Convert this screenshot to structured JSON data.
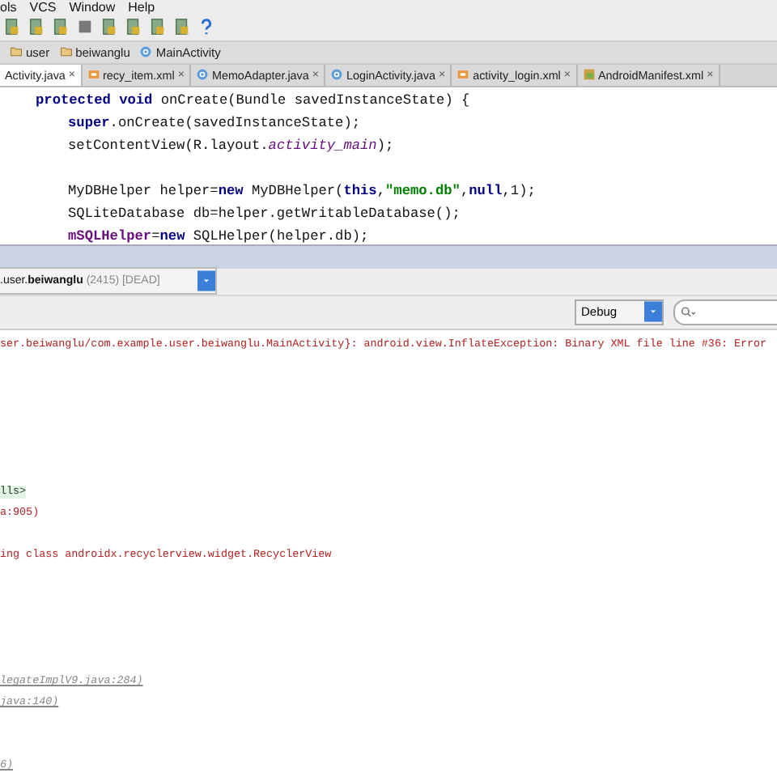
{
  "menu_bar": [
    "ols",
    "VCS",
    "Window",
    "Help"
  ],
  "toolbar": [
    {
      "kind": "tool"
    },
    {
      "kind": "tool"
    },
    {
      "kind": "tool"
    },
    {
      "kind": "stop"
    },
    {
      "kind": "tool"
    },
    {
      "kind": "tool"
    },
    {
      "kind": "tool"
    },
    {
      "kind": "tool"
    },
    {
      "kind": "help"
    }
  ],
  "breadcrumb": [
    {
      "label": "user",
      "kind": "folder"
    },
    {
      "label": "beiwanglu",
      "kind": "folder"
    },
    {
      "label": "MainActivity",
      "kind": "class"
    }
  ],
  "tabs": [
    {
      "label": "Activity.java",
      "kind": "none",
      "selected": true
    },
    {
      "label": "recy_item.xml",
      "kind": "xml",
      "selected": false
    },
    {
      "label": "MemoAdapter.java",
      "kind": "class",
      "selected": false
    },
    {
      "label": "LoginActivity.java",
      "kind": "class",
      "selected": false
    },
    {
      "label": "activity_login.xml",
      "kind": "xml",
      "selected": false
    },
    {
      "label": "AndroidManifest.xml",
      "kind": "manifest",
      "selected": false
    }
  ],
  "tab_close": "×",
  "code": [
    {
      "kind": "signature",
      "tokens": [
        {
          "text": "protected void ",
          "kind": "keyword"
        },
        {
          "text": "onCreate(Bundle savedInstanceState) {",
          "kind": "plain"
        }
      ]
    },
    {
      "kind": "body",
      "tokens": [
        {
          "text": "super",
          "kind": "keyword"
        },
        {
          "text": ".onCreate(savedInstanceState);",
          "kind": "plain"
        }
      ]
    },
    {
      "kind": "body",
      "tokens": [
        {
          "text": "setContentView(R.layout.",
          "kind": "plain"
        },
        {
          "text": "activity_main",
          "kind": "field"
        },
        {
          "text": ");",
          "kind": "plain"
        }
      ]
    },
    {
      "kind": "blank"
    },
    {
      "kind": "body",
      "tokens": [
        {
          "text": "MyDBHelper helper=",
          "kind": "plain"
        },
        {
          "text": "new ",
          "kind": "keyword"
        },
        {
          "text": "MyDBHelper(",
          "kind": "plain"
        },
        {
          "text": "this",
          "kind": "keyword"
        },
        {
          "text": ",",
          "kind": "plain"
        },
        {
          "text": "\"memo.db\"",
          "kind": "string"
        },
        {
          "text": ",",
          "kind": "plain"
        },
        {
          "text": "null",
          "kind": "keyword"
        },
        {
          "text": ",1);",
          "kind": "plain"
        }
      ]
    },
    {
      "kind": "body",
      "tokens": [
        {
          "text": "SQLiteDatabase db=helper.getWritableDatabase();",
          "kind": "plain"
        }
      ]
    },
    {
      "kind": "body",
      "tokens": [
        {
          "text": "mSQLHelper",
          "kind": "member"
        },
        {
          "text": "=",
          "kind": "plain"
        },
        {
          "text": "new ",
          "kind": "keyword"
        },
        {
          "text": "SQLHelper(helper.db);",
          "kind": "plain"
        }
      ]
    }
  ],
  "process": {
    "prefix": ".user.",
    "name": "beiwanglu",
    "suffix": "(2415) [DEAD]"
  },
  "log_level": "Debug",
  "log": [
    {
      "kind": "error",
      "text": "ser.beiwanglu/com.example.user.beiwanglu.MainActivity}: android.view.InflateException: Binary XML file line #36: Error"
    },
    {
      "kind": "gap"
    },
    {
      "kind": "gap"
    },
    {
      "kind": "gap"
    },
    {
      "kind": "gap"
    },
    {
      "kind": "gap"
    },
    {
      "kind": "gap"
    },
    {
      "kind": "frames",
      "text": "lls>"
    },
    {
      "kind": "error",
      "text": "a:905)"
    },
    {
      "kind": "gap"
    },
    {
      "kind": "error",
      "text": "ing class androidx.recyclerview.widget.RecyclerView"
    },
    {
      "kind": "gap"
    },
    {
      "kind": "gap"
    },
    {
      "kind": "gap"
    },
    {
      "kind": "gap"
    },
    {
      "kind": "gap"
    },
    {
      "kind": "link",
      "text": "legateImplV9.java:284)"
    },
    {
      "kind": "link",
      "text": "java:140)"
    },
    {
      "kind": "gap"
    },
    {
      "kind": "gap"
    },
    {
      "kind": "link",
      "text": "6)"
    }
  ]
}
